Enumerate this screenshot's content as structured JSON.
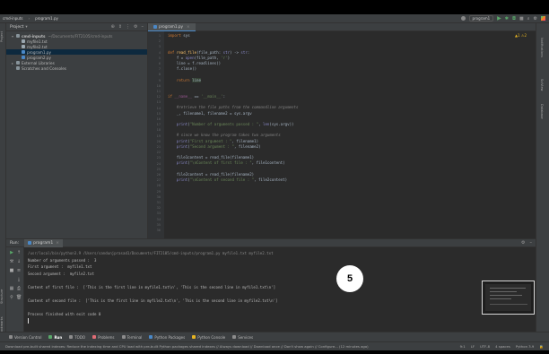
{
  "titlebar": {
    "breadcrumb_project": "cmd-inputs",
    "breadcrumb_file": "program1.py",
    "run_config": "program1"
  },
  "project_panel": {
    "title": "Project",
    "items": [
      {
        "label": "cmd-inputs",
        "path": "~/Documents/FIT2105/cmd-inputs",
        "indent": 1,
        "selected": false,
        "icon": "folder-icon"
      },
      {
        "label": "myfile1.txt",
        "path": "",
        "indent": 2,
        "selected": false,
        "icon": "text-file-icon"
      },
      {
        "label": "myfile2.txt",
        "path": "",
        "indent": 2,
        "selected": false,
        "icon": "text-file-icon"
      },
      {
        "label": "program1.py",
        "path": "",
        "indent": 2,
        "selected": true,
        "icon": "python-file-icon"
      },
      {
        "label": "program2.py",
        "path": "",
        "indent": 2,
        "selected": false,
        "icon": "python-file-icon"
      },
      {
        "label": "External Libraries",
        "path": "",
        "indent": 1,
        "selected": false,
        "icon": "library-icon"
      },
      {
        "label": "Scratches and Consoles",
        "path": "",
        "indent": 1,
        "selected": false,
        "icon": "scratch-icon"
      }
    ]
  },
  "editor": {
    "tab_label": "program1.py",
    "status": "▲1 ⚠2",
    "line_numbers": [
      "1",
      "2",
      "3",
      "4",
      "5",
      "6",
      "7",
      "8",
      "9",
      "10",
      "11",
      "12",
      "13",
      "14",
      "15",
      "16",
      "17",
      "18",
      "19",
      "20",
      "21",
      "22",
      "23",
      "24",
      "25",
      "26",
      "27",
      "28",
      "29",
      "30",
      "31",
      "32",
      "33",
      "34",
      "35",
      "36"
    ]
  },
  "run_panel": {
    "header": "Run:",
    "tab_label": "program1",
    "console_lines": [
      "/usr/local/bin/python3.9 /Users/sandunjprasad1/Documents/FIT2105/cmd-inputs/program1.py myfile1.txt myfile2.txt",
      "Number of arguments passed :  3",
      "First argument :  myfile1.txt",
      "Second argument :  myfile2.txt",
      "",
      "Content of first file :  ['This is the first line in myfile1.txt\\n', 'This is the second line in myfile1.txt\\n']",
      "",
      "Content of second file :  ['This is the first line in myfile2.txt\\n', 'This is the second line in myfile2.txt\\n']",
      "",
      "Process finished with exit code 0"
    ]
  },
  "overlay_badge": "5",
  "bottom_tabs": [
    {
      "label": "Version Control",
      "active": false,
      "color": "#8c8c8c"
    },
    {
      "label": "Run",
      "active": true,
      "color": "#59a869"
    },
    {
      "label": "TODO",
      "active": false,
      "color": "#8c8c8c"
    },
    {
      "label": "Problems",
      "active": false,
      "color": "#e06c75"
    },
    {
      "label": "Terminal",
      "active": false,
      "color": "#8c8c8c"
    },
    {
      "label": "Python Packages",
      "active": false,
      "color": "#4a88c7"
    },
    {
      "label": "Python Console",
      "active": false,
      "color": "#e6b422"
    },
    {
      "label": "Services",
      "active": false,
      "color": "#8c8c8c"
    }
  ],
  "statusbar": {
    "message": "Download pre-built shared indexes: Reduce the indexing time and CPU load with pre-built Python packages shared indexes // Always download // Download once // Don't show again // Configure... (12 minutes ago)",
    "position": "9:1",
    "line_sep": "LF",
    "encoding": "UTF-8",
    "indent": "4 spaces",
    "interpreter": "Python 3.9"
  },
  "left_tool_tabs": [
    "Project",
    "Structure",
    "Bookmarks"
  ],
  "right_tool_tabs": [
    "Notifications",
    "SciView",
    "Database"
  ]
}
